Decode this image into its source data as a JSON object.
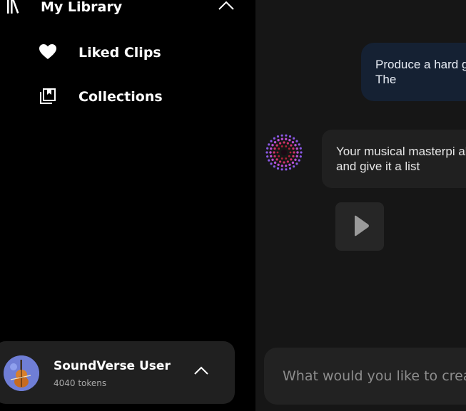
{
  "sidebar": {
    "library": {
      "title": "My Library",
      "icon": "library-books-icon",
      "toggle_icon": "chevron-up-icon"
    },
    "items": [
      {
        "label": "Liked Clips",
        "icon": "heart-icon"
      },
      {
        "label": "Collections",
        "icon": "collections-icon"
      }
    ],
    "user": {
      "name": "SoundVerse User",
      "tokens": "4040 tokens",
      "avatar_icon": "cello-avatar-icon",
      "toggle_icon": "chevron-up-icon"
    }
  },
  "chat": {
    "messages": [
      {
        "role": "user",
        "text": "Produce a hard guitar in it. The"
      },
      {
        "role": "assistant",
        "text": "Your musical masterpi ahead and give it a list"
      }
    ],
    "play_icon": "play-icon",
    "bot_avatar_icon": "soundverse-orb-icon",
    "prompt_placeholder": "What would you like to create"
  },
  "colors": {
    "sidebar_bg": "#000000",
    "chat_bg": "#161616",
    "user_bubble": "#152133",
    "bot_bubble": "#202020",
    "card_bg": "#202020"
  }
}
